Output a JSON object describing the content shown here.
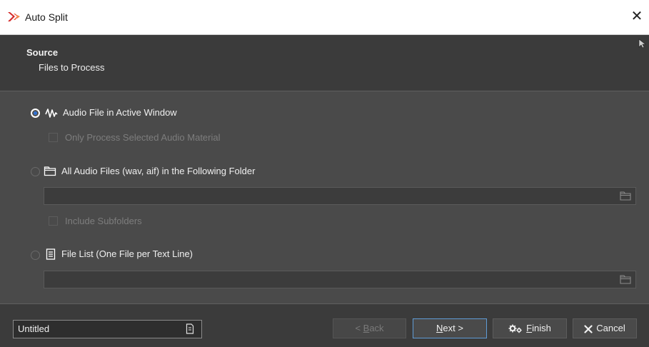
{
  "window": {
    "title": "Auto Split"
  },
  "header": {
    "title": "Source",
    "subtitle": "Files to Process"
  },
  "options": {
    "active_window": {
      "label": "Audio File in Active Window",
      "selected": true
    },
    "only_selected": {
      "label": "Only Process Selected Audio Material",
      "checked": false,
      "enabled": false
    },
    "folder": {
      "label": "All Audio Files (wav, aif) in the Following Folder",
      "selected": false,
      "path": ""
    },
    "include_subfolders": {
      "label": "Include Subfolders",
      "checked": false,
      "enabled": false
    },
    "file_list": {
      "label": "File List (One File per Text Line)",
      "selected": false,
      "path": ""
    }
  },
  "footer": {
    "preset_name": "Untitled",
    "back_prefix": "< ",
    "back_mnemonic": "B",
    "back_rest": "ack",
    "next_mnemonic": "N",
    "next_rest": "ext >",
    "finish_mnemonic": "F",
    "finish_rest": "inish",
    "cancel_label": "Cancel"
  },
  "colors": {
    "accent": "#2e6fd0",
    "logo": "#d42a2a",
    "primary_border": "#5f9bd5"
  },
  "icons": [
    "app-logo-icon",
    "close-icon",
    "waveform-icon",
    "folder-icon",
    "file-list-icon",
    "folder-browse-icon",
    "save-preset-icon",
    "gears-icon",
    "cancel-x-icon"
  ]
}
